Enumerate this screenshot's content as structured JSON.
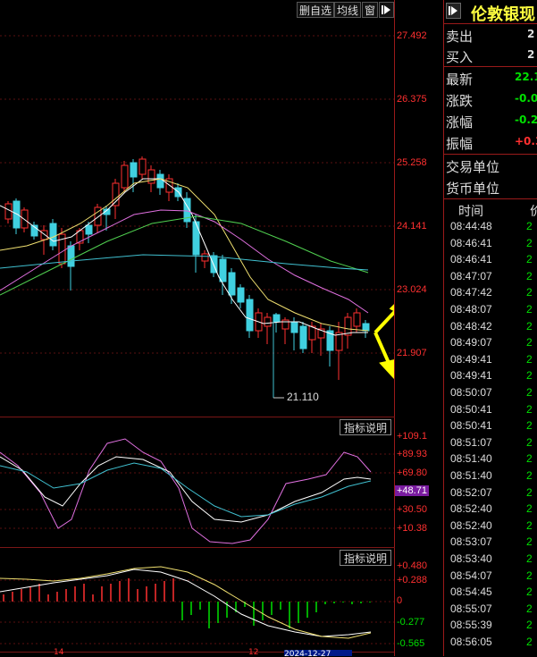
{
  "toolbar": {
    "btn_remove_watchlist": "删自选",
    "btn_ma_line": "均线",
    "btn_window": "窗"
  },
  "main_axis": {
    "labels": [
      "27.492",
      "26.375",
      "25.258",
      "24.141",
      "23.024",
      "21.907"
    ]
  },
  "annotations": {
    "low_price": "21.110"
  },
  "kdj": {
    "button": "指标说明",
    "labels": [
      "+109.1",
      "+89.93",
      "+69.80",
      "+48.71",
      "+30.50",
      "+10.38"
    ],
    "current": "+48.71"
  },
  "macd": {
    "button": "指标说明",
    "labels": [
      "+0.480",
      "+0.288",
      "0",
      "-0.277",
      "-0.565"
    ]
  },
  "bottom_axis": {
    "left_mark": "14",
    "right_mark": "12",
    "date_box": "2024-12-27"
  },
  "quote": {
    "title": "伦敦银现",
    "rows": [
      {
        "label": "卖出",
        "value": "2"
      },
      {
        "label": "买入",
        "value": "2"
      },
      {
        "label": "最新",
        "value": "22.1"
      },
      {
        "label": "涨跌",
        "value": "-0.0"
      },
      {
        "label": "涨幅",
        "value": "-0.2"
      },
      {
        "label": "振幅",
        "value": "+0.3"
      },
      {
        "label": "交易单位",
        "value": ""
      },
      {
        "label": "货币单位",
        "value": ""
      }
    ],
    "colors": {
      "up": "#ff3030",
      "down": "#00e000",
      "neutral": "#dddddd"
    }
  },
  "ticks": {
    "header_time": "时间",
    "header_price": "价",
    "times": [
      "08:44:48",
      "08:46:41",
      "08:46:41",
      "08:47:07",
      "08:47:42",
      "08:48:07",
      "08:48:42",
      "08:49:07",
      "08:49:41",
      "08:49:41",
      "08:50:07",
      "08:50:41",
      "08:50:41",
      "08:51:07",
      "08:51:40",
      "08:51:40",
      "08:52:07",
      "08:52:40",
      "08:52:40",
      "08:53:07",
      "08:53:40",
      "08:54:07",
      "08:54:45",
      "08:55:07",
      "08:55:39",
      "08:56:05"
    ],
    "price_prefix": "2"
  },
  "chart_data": {
    "type": "candlestick",
    "ylim": [
      21.0,
      27.6
    ],
    "low_marked": 21.11
  }
}
